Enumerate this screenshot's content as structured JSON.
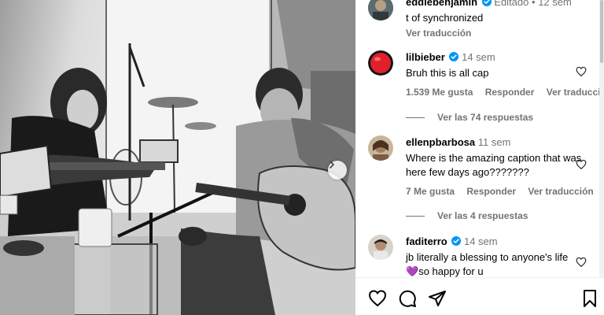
{
  "post": {
    "photo_alt": "Black-and-white photo of two people playing guitars in a studio",
    "next_icon": "chevron-right-icon"
  },
  "comments": [
    {
      "username": "eddiebenjamin",
      "verified": true,
      "edited_label": "Editado",
      "dot": "•",
      "time": "12 sem",
      "text": "t of synchronized",
      "translate": "Ver traducción"
    },
    {
      "username": "lilbieber",
      "verified": true,
      "time": "14 sem",
      "text": "Bruh this is all cap",
      "likes": "1.539 Me gusta",
      "reply": "Responder",
      "translate": "Ver traducción",
      "view_replies": "Ver las 74 respuestas"
    },
    {
      "username": "ellenpbarbosa",
      "verified": false,
      "time": "11 sem",
      "text": "Where is the amazing caption that was here few days ago???????",
      "likes": "7 Me gusta",
      "reply": "Responder",
      "translate": "Ver traducción",
      "view_replies": "Ver las 4 respuestas"
    },
    {
      "username": "faditerro",
      "verified": true,
      "time": "14 sem",
      "text_line1": "jb literally a blessing to anyone's life",
      "text_line2": "so happy for u",
      "heart_emoji": "💜"
    }
  ],
  "action_bar": {
    "icons": [
      "heart-icon",
      "comment-icon",
      "share-icon",
      "bookmark-icon"
    ]
  },
  "colors": {
    "verified": "#0095f6",
    "secondary_text": "#737373",
    "avatar_red": "#e0202b"
  }
}
